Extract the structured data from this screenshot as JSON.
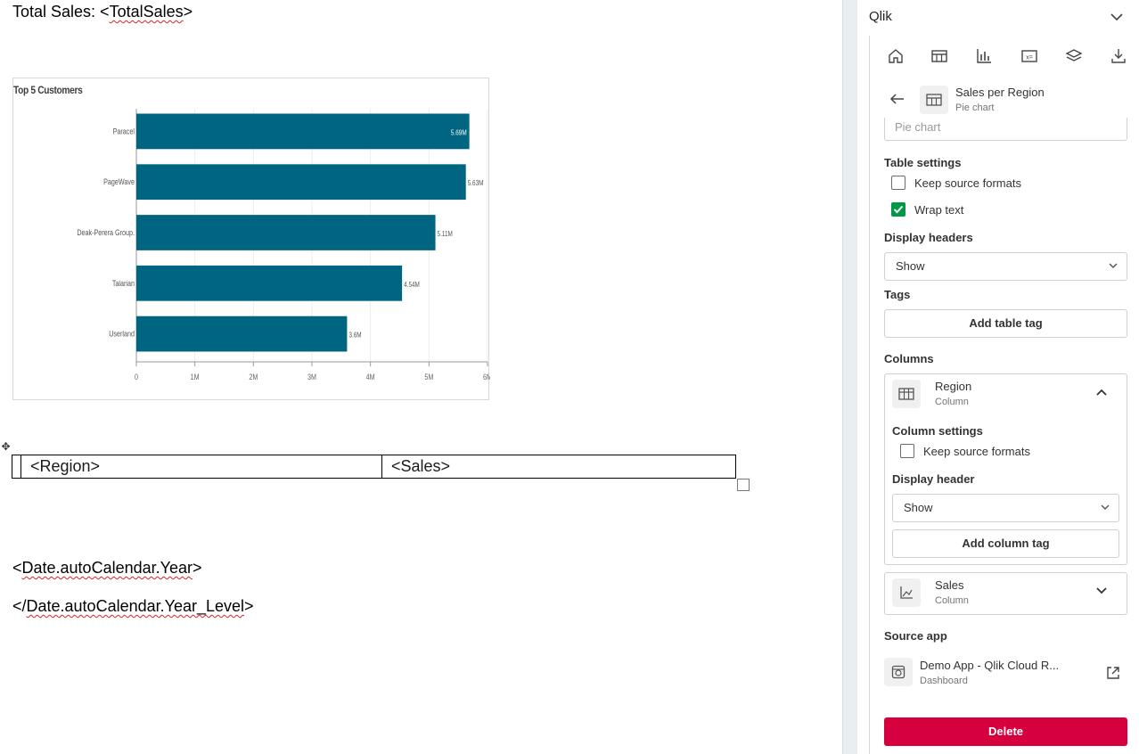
{
  "document": {
    "total_sales_prefix": "Total Sales: <",
    "total_sales_token": "TotalSales",
    "total_sales_suffix": ">",
    "table": {
      "col1": "<Region>",
      "col2": "<Sales>"
    },
    "line_year_open": "<",
    "line_year_token": "Date.autoCalendar.Year",
    "line_year_close": ">",
    "line_level_open": "</",
    "line_level_token": "Date.autoCalendar.Year_Level",
    "line_level_close": ">",
    "move_handle_glyph": "✥"
  },
  "chart_data": {
    "type": "bar",
    "orientation": "horizontal",
    "title": "Top 5 Customers",
    "categories": [
      "Paracel",
      "PageWave",
      "Deak-Perera Group.",
      "Talarian",
      "Userland"
    ],
    "values": [
      5.69,
      5.63,
      5.11,
      4.54,
      3.6
    ],
    "value_labels": [
      "5.69M",
      "5.63M",
      "5.11M",
      "4.54M",
      "3.6M"
    ],
    "x_ticks": [
      "0",
      "1M",
      "2M",
      "3M",
      "4M",
      "5M",
      "6M"
    ],
    "xlim": [
      0,
      6
    ],
    "grid": true,
    "bar_color": "#006580"
  },
  "panel": {
    "title": "Qlik",
    "toolbar_icons": [
      "home-icon",
      "table-icon",
      "chart-icon",
      "variable-icon",
      "layers-icon",
      "download-icon"
    ],
    "object": {
      "title": "Sales per Region",
      "subtitle": "Pie chart"
    },
    "name_field_value": "Pie chart",
    "table_settings": {
      "heading": "Table settings",
      "keep_source_formats": {
        "label": "Keep source formats",
        "checked": false
      },
      "wrap_text": {
        "label": "Wrap text",
        "checked": true
      }
    },
    "display_headers": {
      "label": "Display headers",
      "value": "Show"
    },
    "tags": {
      "label": "Tags",
      "button": "Add table tag"
    },
    "columns": {
      "label": "Columns",
      "region": {
        "name": "Region",
        "type": "Column",
        "settings_heading": "Column settings",
        "keep_source_formats": {
          "label": "Keep source formats",
          "checked": false
        },
        "display_header": {
          "label": "Display header",
          "value": "Show"
        },
        "add_tag_button": "Add column tag"
      },
      "sales": {
        "name": "Sales",
        "type": "Column"
      }
    },
    "source_app": {
      "label": "Source app",
      "name": "Demo App - Qlik Cloud R...",
      "type": "Dashboard"
    },
    "delete_button": "Delete",
    "accent_green": "#009845",
    "danger_red": "#d7003e"
  }
}
